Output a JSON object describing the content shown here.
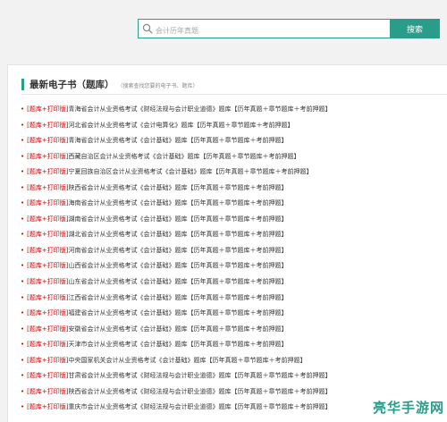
{
  "search": {
    "placeholder": "会计历年真题",
    "button_label": "搜索"
  },
  "section": {
    "title": "最新电子书（题库）",
    "subtitle": "（搜索查找您要的电子书、题库）"
  },
  "books": [
    {
      "tag": "[题库+打印版]",
      "title": "青海省会计从业资格考试《财经法规与会计职业道德》题库【历年真题＋章节题库＋考前押题】"
    },
    {
      "tag": "[题库+打印版]",
      "title": "河北省会计从业资格考试《会计电算化》题库【历年真题＋章节题库＋考前押题】"
    },
    {
      "tag": "[题库+打印版]",
      "title": "青海省会计从业资格考试《会计基础》题库【历年真题＋章节题库＋考前押题】"
    },
    {
      "tag": "[题库+打印版]",
      "title": "西藏自治区会计从业资格考试《会计基础》题库【历年真题＋章节题库＋考前押题】"
    },
    {
      "tag": "[题库+打印版]",
      "title": "宁夏回族自治区会计从业资格考试《会计基础》题库【历年真题＋章节题库＋考前押题】"
    },
    {
      "tag": "[题库+打印版]",
      "title": "陕西省会计从业资格考试《会计基础》题库【历年真题＋章节题库＋考前押题】"
    },
    {
      "tag": "[题库+打印版]",
      "title": "海南省会计从业资格考试《会计基础》题库【历年真题＋章节题库＋考前押题】"
    },
    {
      "tag": "[题库+打印版]",
      "title": "湖南省会计从业资格考试《会计基础》题库【历年真题＋章节题库＋考前押题】"
    },
    {
      "tag": "[题库+打印版]",
      "title": "湖北省会计从业资格考试《会计基础》题库【历年真题＋章节题库＋考前押题】"
    },
    {
      "tag": "[题库+打印版]",
      "title": "河南省会计从业资格考试《会计基础》题库【历年真题＋章节题库＋考前押题】"
    },
    {
      "tag": "[题库+打印版]",
      "title": "山西省会计从业资格考试《会计基础》题库【历年真题＋章节题库＋考前押题】"
    },
    {
      "tag": "[题库+打印版]",
      "title": "山东省会计从业资格考试《会计基础》题库【历年真题＋章节题库＋考前押题】"
    },
    {
      "tag": "[题库+打印版]",
      "title": "江西省会计从业资格考试《会计基础》题库【历年真题＋章节题库＋考前押题】"
    },
    {
      "tag": "[题库+打印版]",
      "title": "福建省会计从业资格考试《会计基础》题库【历年真题＋章节题库＋考前押题】"
    },
    {
      "tag": "[题库+打印版]",
      "title": "安徽省会计从业资格考试《会计基础》题库【历年真题＋章节题库＋考前押题】"
    },
    {
      "tag": "[题库+打印版]",
      "title": "天津市会计从业资格考试《会计基础》题库【历年真题＋章节题库＋考前押题】"
    },
    {
      "tag": "[题库+打印版]",
      "title": "中央国家机关会计从业资格考试《会计基础》题库【历年真题＋章节题库＋考前押题】"
    },
    {
      "tag": "[题库+打印版]",
      "title": "甘肃省会计从业资格考试《财经法规与会计职业道德》题库【历年真题＋章节题库＋考前押题】"
    },
    {
      "tag": "[题库+打印版]",
      "title": "陕西省会计从业资格考试《财经法规与会计职业道德》题库【历年真题＋章节题库＋考前押题】"
    },
    {
      "tag": "[题库+打印版]",
      "title": "重庆市会计从业资格考试《财经法规与会计职业道德》题库【历年真题＋章节题库＋考前押题】"
    }
  ],
  "watermark": {
    "text": "亮华手游网"
  },
  "colors": {
    "accent": "#2a9d8a",
    "tag": "#cc0000"
  },
  "icons": {
    "search": "search-icon"
  }
}
